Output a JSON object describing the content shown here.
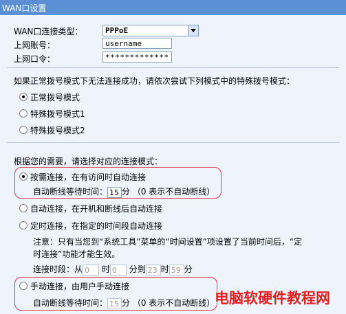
{
  "window": {
    "title": "WAN口设置"
  },
  "fields": {
    "conn_type_label": "WAN口连接类型：",
    "conn_type_value": "PPPoE",
    "account_label": "上网账号：",
    "account_value": "username",
    "password_label": "上网口令：",
    "password_value": "*************"
  },
  "dial": {
    "prompt": "如果正常拨号模式下无法连接成功，请依次尝试下列模式中的特殊拨号模式：",
    "modes": [
      {
        "label": "正常拨号模式",
        "selected": true
      },
      {
        "label": "特殊拨号模式1",
        "selected": false
      },
      {
        "label": "特殊拨号模式2",
        "selected": false
      }
    ]
  },
  "connect": {
    "prompt": "根据您的需要，请选择对应的连接模式：",
    "on_demand": {
      "label": "按需连接，在有访问时自动连接",
      "selected": true,
      "idle_label": "自动断线等待时间：",
      "idle_value": "15",
      "idle_unit": "分",
      "idle_note": "（0 表示不自动断线）"
    },
    "auto": {
      "label": "自动连接，在开机和断线后自动连接",
      "selected": false
    },
    "timed": {
      "label": "定时连接，在指定的时间段自动连接",
      "selected": false,
      "note_line1": "注意：只有当您到“系统工具”菜单的“时间设置”项设置了当前时间后，“定",
      "note_line2": "时连接”功能才能生效。",
      "period_label": "连接时段：从",
      "from_hour": "0",
      "hour_label": "时",
      "from_min": "0",
      "to_label": "分到",
      "to_hour": "23",
      "hour_label2": "时",
      "to_min": "59",
      "min_label": "分"
    },
    "manual": {
      "label": "手动连接，由用户手动连接",
      "selected": false,
      "idle_label": "自动断线等待时间：",
      "idle_value": "15",
      "idle_unit": "分",
      "idle_note": "（0 表示不自动断线）"
    }
  },
  "watermark": "电脑软硬件教程网"
}
